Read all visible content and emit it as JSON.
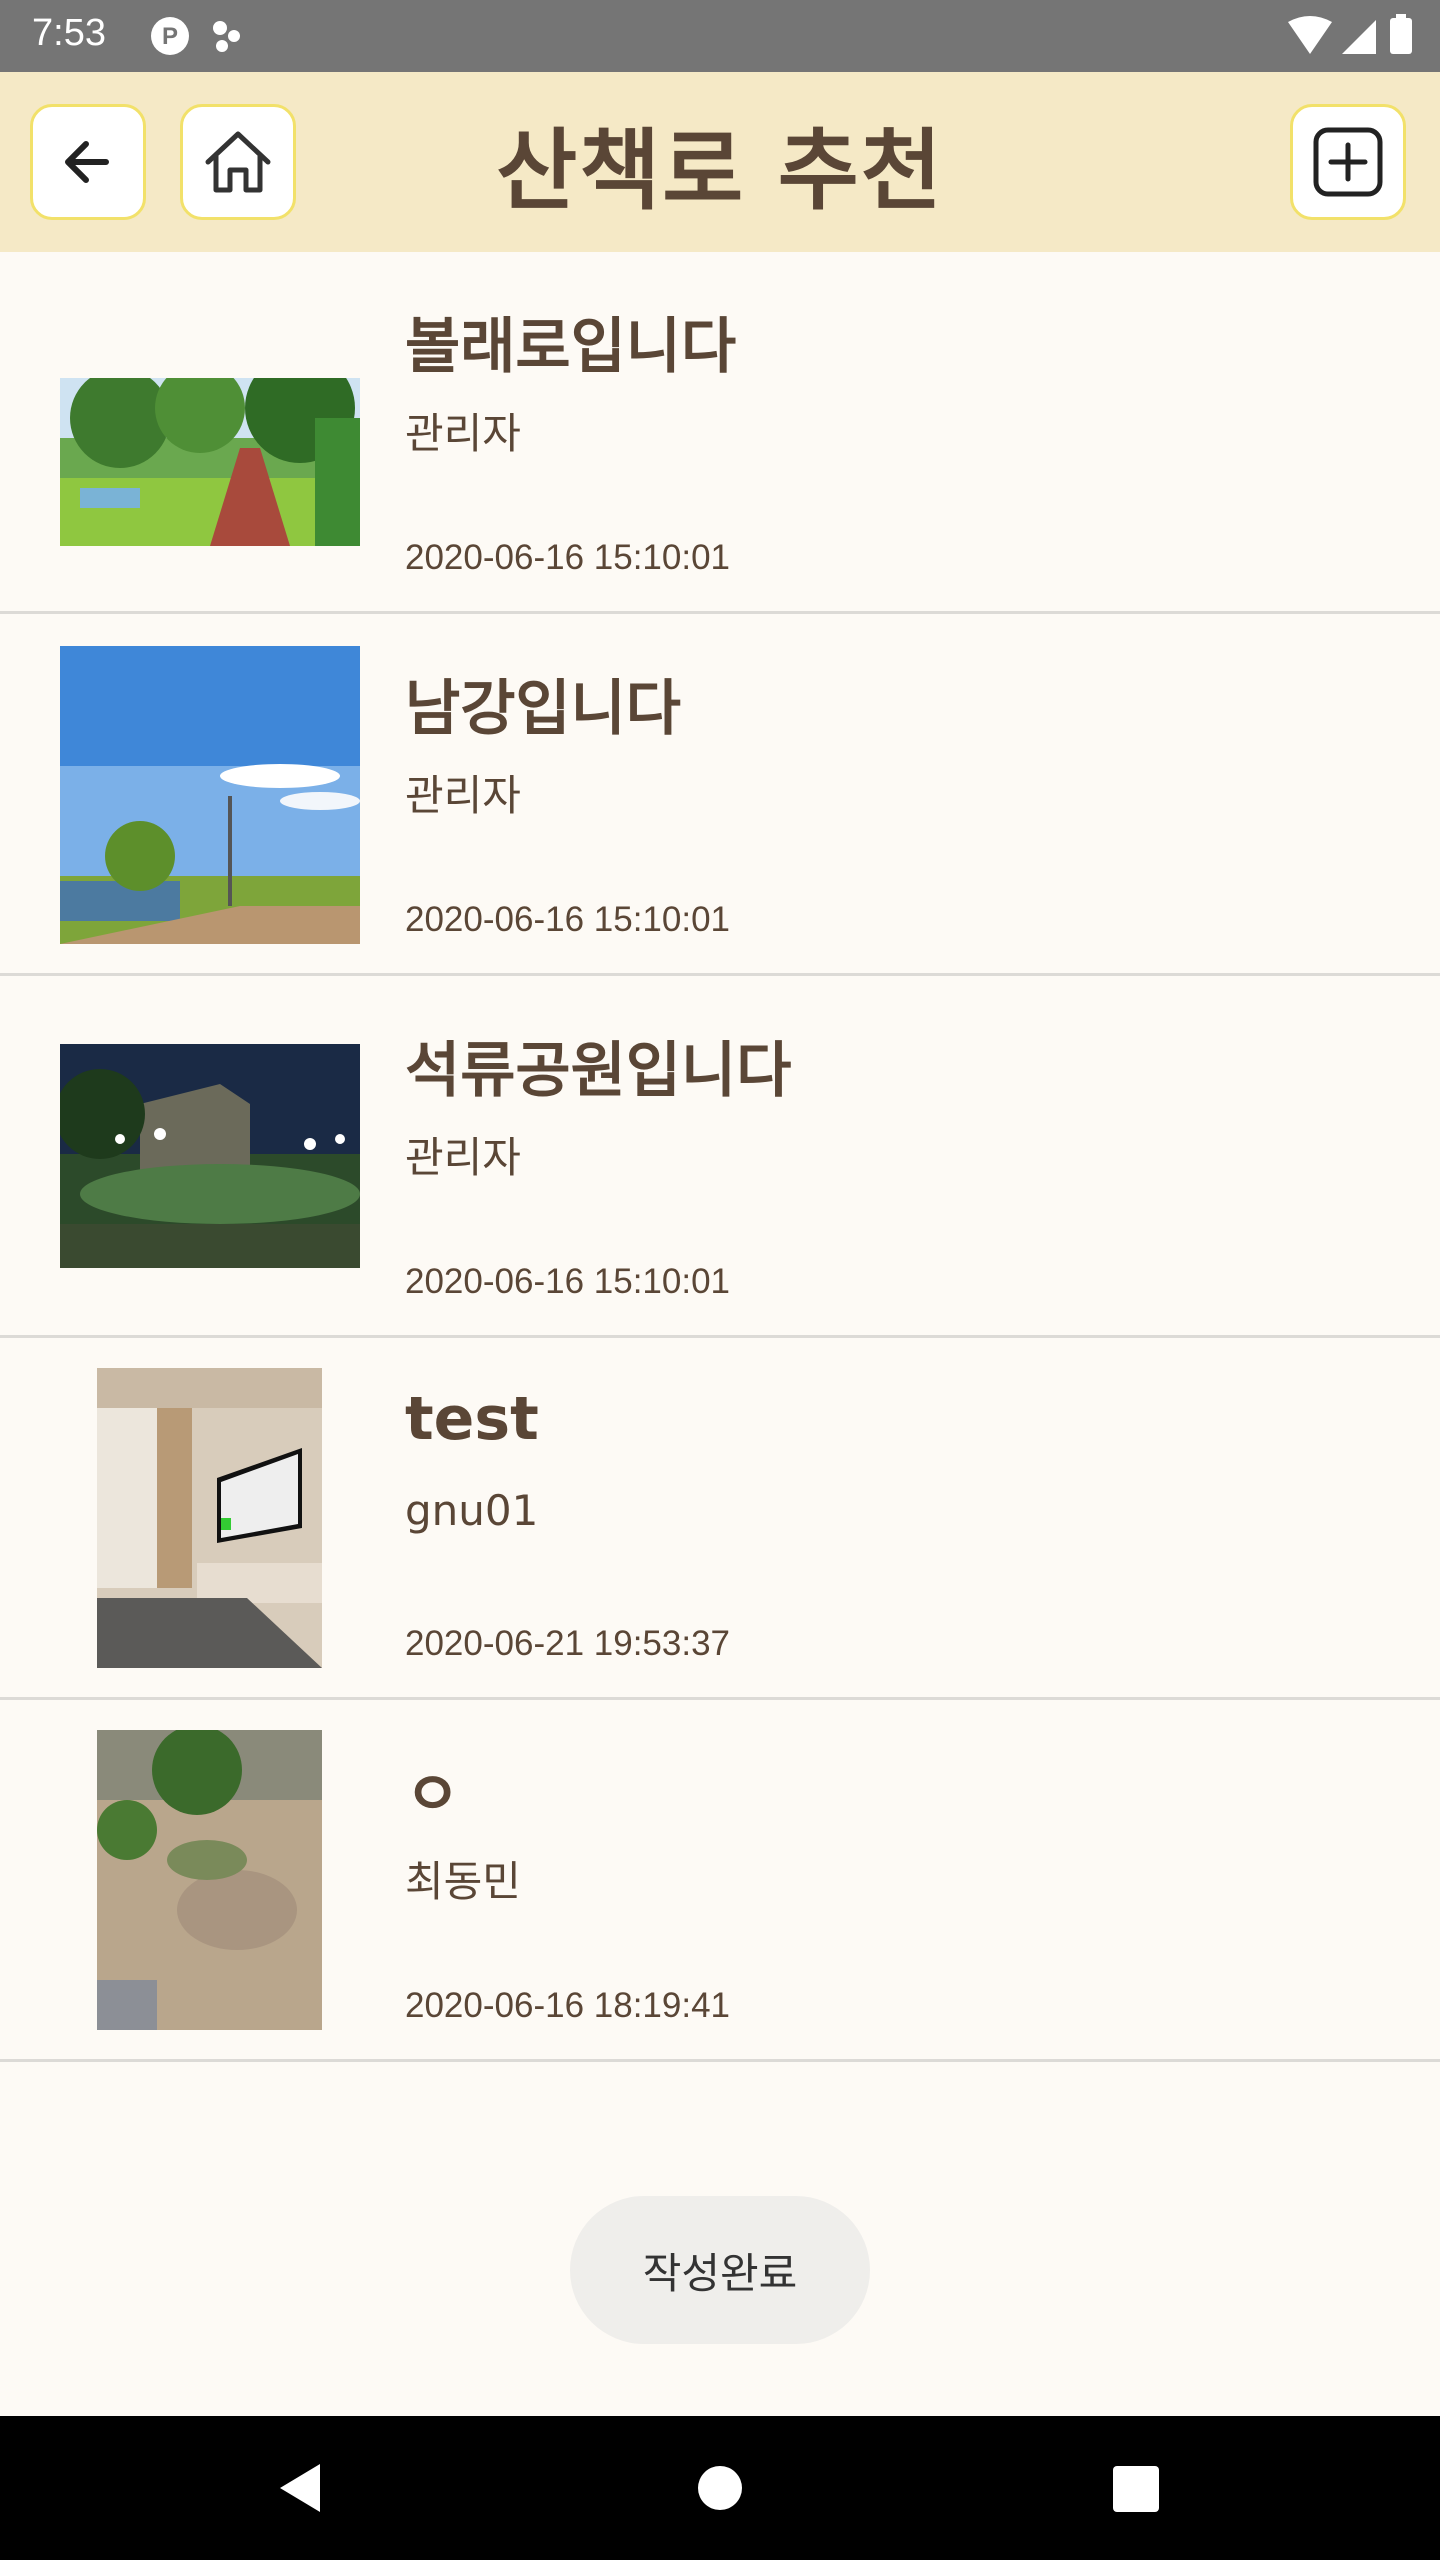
{
  "status_bar": {
    "time": "7:53"
  },
  "header": {
    "title": "산책로 추천",
    "back_icon": "arrow-left-icon",
    "home_icon": "home-icon",
    "add_icon": "plus-square-icon"
  },
  "posts": [
    {
      "title": "볼래로입니다",
      "author": "관리자",
      "date": "2020-06-16 15:10:01",
      "thumbnail": "path-with-trees-photo"
    },
    {
      "title": "남강입니다",
      "author": "관리자",
      "date": "2020-06-16 15:10:01",
      "thumbnail": "river-park-sky-photo"
    },
    {
      "title": "석류공원입니다",
      "author": "관리자",
      "date": "2020-06-16 15:10:01",
      "thumbnail": "night-park-photo"
    },
    {
      "title": "test",
      "author": "gnu01",
      "date": "2020-06-21 19:53:37",
      "thumbnail": "room-with-tv-photo"
    },
    {
      "title": "ㅇ",
      "author": "최동민",
      "date": "2020-06-16 18:19:41",
      "thumbnail": "garden-ground-photo"
    }
  ],
  "submit_label": "작성완료",
  "colors": {
    "app_bar": "#f5e9c6",
    "button_border": "#f2e16a",
    "text": "#5a4636",
    "background": "#fdfaf5"
  }
}
